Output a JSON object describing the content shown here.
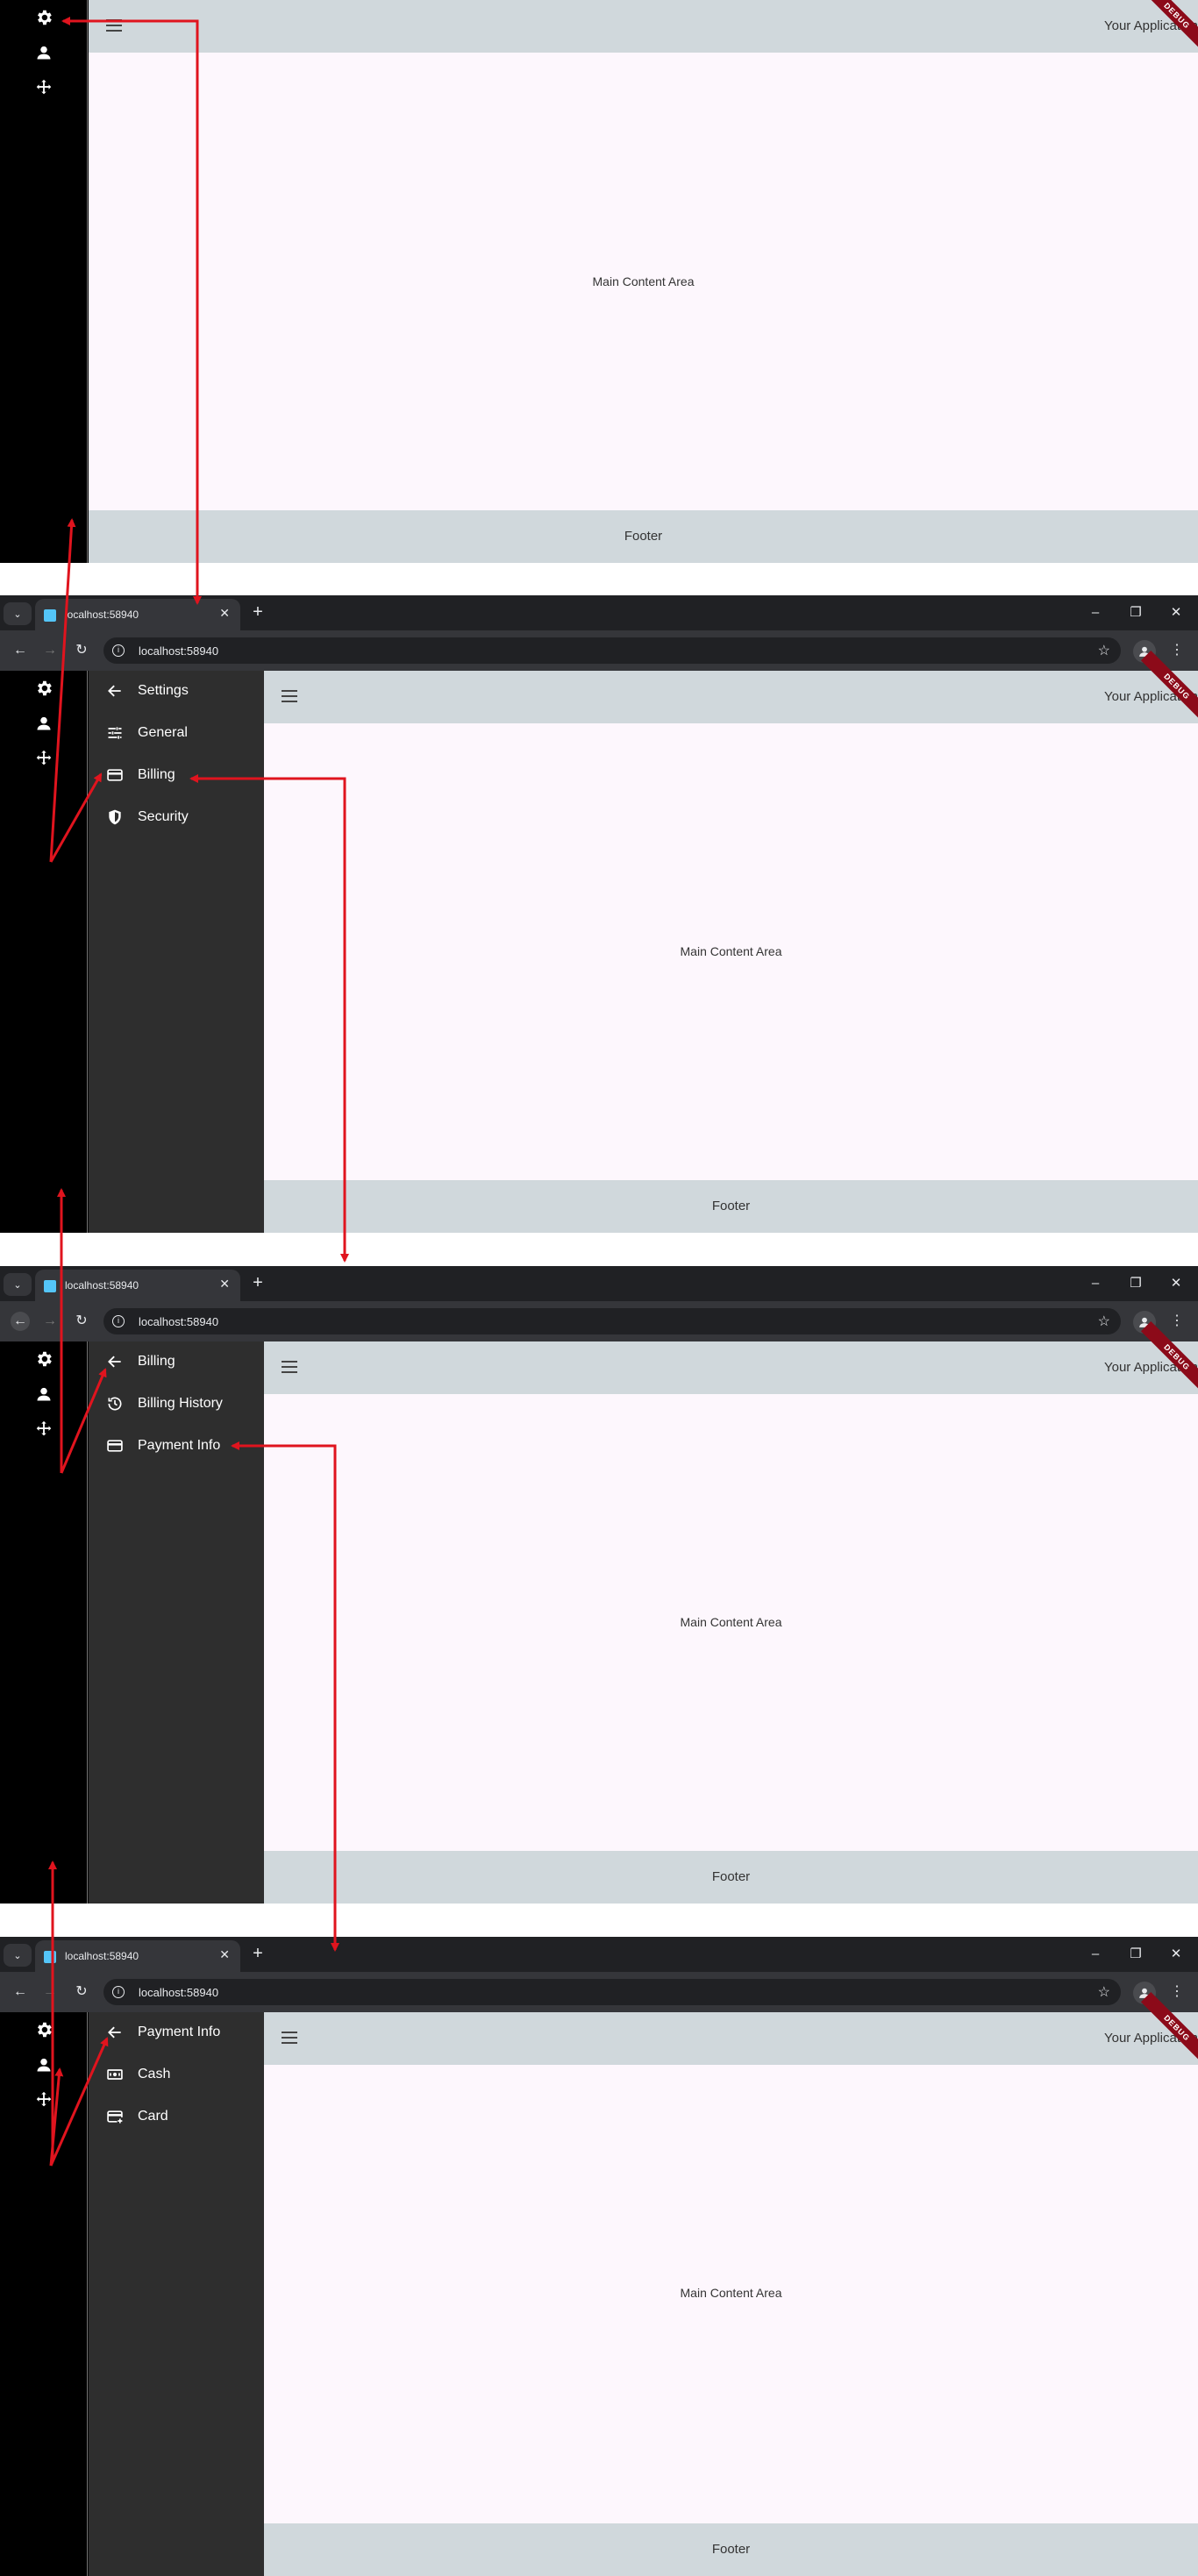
{
  "app": {
    "title": "Your Application",
    "main_text": "Main Content Area",
    "footer": "Footer",
    "debug_banner": "DEBUG"
  },
  "browser": {
    "tab_title": "localhost:58940",
    "url": "localhost:58940"
  },
  "rail": {
    "icons": [
      "gear-icon",
      "person-icon",
      "move-icon"
    ]
  },
  "panels": [
    {
      "header": "Settings",
      "items": [
        {
          "label": "General",
          "icon": "tune-icon"
        },
        {
          "label": "Billing",
          "icon": "credit-card-icon"
        },
        {
          "label": "Security",
          "icon": "shield-icon"
        }
      ]
    },
    {
      "header": "Billing",
      "items": [
        {
          "label": "Billing History",
          "icon": "history-icon"
        },
        {
          "label": "Payment Info",
          "icon": "credit-card-icon"
        }
      ]
    },
    {
      "header": "Payment Info",
      "items": [
        {
          "label": "Cash",
          "icon": "cash-icon"
        },
        {
          "label": "Card",
          "icon": "add-card-icon"
        }
      ]
    }
  ],
  "colors": {
    "arrow": "#e0141e",
    "rail": "#000000",
    "panel": "#2e2e2e",
    "appbar": "#d0d8dc",
    "content": "#fdf7fd",
    "banner": "#8c0a19"
  }
}
